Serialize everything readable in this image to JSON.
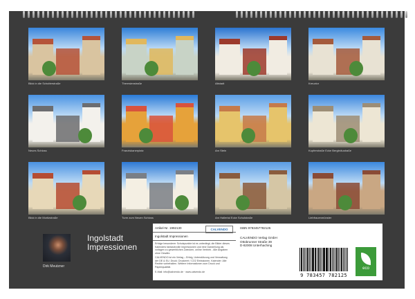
{
  "grid": [
    {
      "caption": "Blick in die Schutterstraße",
      "colors": {
        "sky": "#3a86dc",
        "bldg": "#d9c4a0",
        "accent": "#b5543a"
      }
    },
    {
      "caption": "Theresienstraße",
      "colors": {
        "sky": "#2f7fd6",
        "bldg": "#c8d3c6",
        "accent": "#e1b85d"
      }
    },
    {
      "caption": "Altstadt",
      "colors": {
        "sky": "#2b74d0",
        "bldg": "#f1ece2",
        "accent": "#9c3a2c"
      }
    },
    {
      "caption": "Kreuztor",
      "colors": {
        "sky": "#3b8ae0",
        "bldg": "#e8e2d3",
        "accent": "#a45a3c"
      }
    },
    {
      "caption": "Neues Schloss",
      "colors": {
        "sky": "#4a93e3",
        "bldg": "#f3f1ec",
        "accent": "#6c6d70"
      }
    },
    {
      "caption": "Franziskanerplatz",
      "colors": {
        "sky": "#2a7bd8",
        "bldg": "#e6a23a",
        "accent": "#d8533d"
      }
    },
    {
      "caption": "Am Stein",
      "colors": {
        "sky": "#5b9ee6",
        "bldg": "#e6c46b",
        "accent": "#c57a4a"
      }
    },
    {
      "caption": "Kupferstraße Ecke Bergbräustraße",
      "colors": {
        "sky": "#3c87dd",
        "bldg": "#ede6d4",
        "accent": "#9c8d76"
      }
    },
    {
      "caption": "Blick in die Moritzstraße",
      "colors": {
        "sky": "#4a92e2",
        "bldg": "#e7d8b8",
        "accent": "#b54c32"
      }
    },
    {
      "caption": "Turm zum Neuen Schloss",
      "colors": {
        "sky": "#2e79d4",
        "bldg": "#f4efe3",
        "accent": "#7a7f86"
      }
    },
    {
      "caption": "Am Hallertal Ecke Schulstraße",
      "colors": {
        "sky": "#5a9ce4",
        "bldg": "#d5c6a5",
        "accent": "#8a5c3e"
      }
    },
    {
      "caption": "Liebfrauenmünster",
      "colors": {
        "sky": "#3b88de",
        "bldg": "#c9a783",
        "accent": "#8a4b36"
      }
    }
  ],
  "author": {
    "name": "Dirk Meutzner"
  },
  "title": {
    "line1": "Ingolstadt",
    "line2": "Impressionen"
  },
  "info": {
    "artikel": "Artikel-Nr. 1992130",
    "logo": "CALVENDO",
    "isbn": "ISBN 9783457782125",
    "subtitle": "Ingolstadt Impressionen",
    "description": "Erfolge besonderer Schutzpunkte ist es unbedingt; die Bilder dieses Kalenders fantasievolle Impressionen und eine Darstellung als vorlagen zu gewerblichen Zwecken, online Vertrieb - Alle Angaben ohne Gewähr.",
    "legal": "CALVENDO ist ein Verlag – Erfolg, Unterstützung und Verwaltung der DE & EU. Druck: Druckerei / CO2 Emissionen. Kalender: Alle Rechte vorbehalten. Weitere Informationen zum Druck und Papierqualität.",
    "email": "E-Mail: info@calvendo.de · www.calvendo.de",
    "publisher": [
      "CALVENDO Verlag GmbH",
      "Ottobrunner Straße 39",
      "D-82008 Unterhaching"
    ],
    "barcode_number": "9 783457 782125",
    "eco_label": "eco"
  }
}
